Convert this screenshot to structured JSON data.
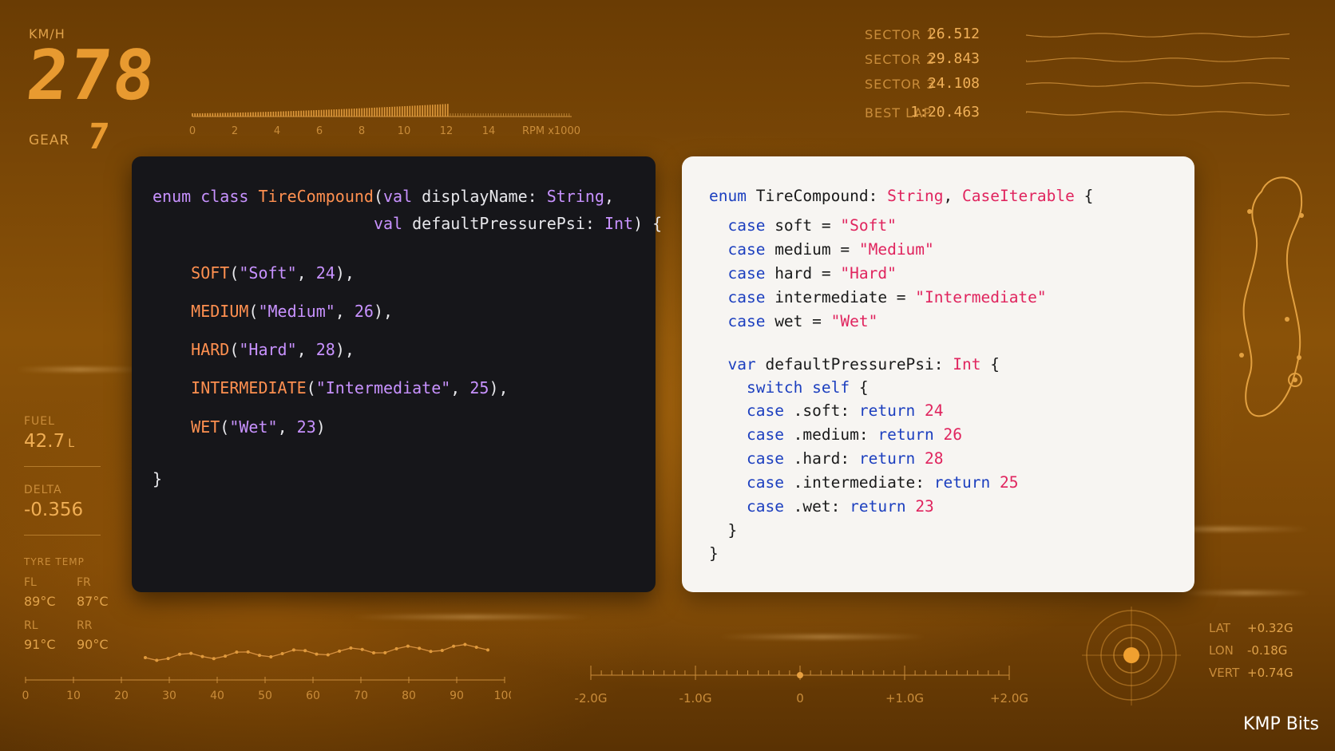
{
  "dashboard": {
    "speed_unit": "KM/H",
    "speed": "278",
    "gear_label": "GEAR",
    "gear": "7",
    "rpm_ticks": [
      "0",
      "2",
      "4",
      "6",
      "8",
      "10",
      "12",
      "14"
    ],
    "rpm_unit": "RPM x1000",
    "rpm_level": 0.68
  },
  "sectors": [
    {
      "label": "SECTOR 1",
      "time": "26.512"
    },
    {
      "label": "SECTOR 2",
      "time": "29.843"
    },
    {
      "label": "SECTOR 3",
      "time": "24.108"
    },
    {
      "label": "BEST LAP",
      "time": "1:20.463"
    }
  ],
  "left_stats": {
    "fuel_label": "FUEL",
    "fuel_value": "42.7",
    "fuel_unit": "L",
    "delta_label": "DELTA",
    "delta_value": "-0.356",
    "tyre_temp_label": "TYRE TEMP",
    "tyres": [
      {
        "pos": "FL",
        "temp": "89°C"
      },
      {
        "pos": "FR",
        "temp": "87°C"
      },
      {
        "pos": "RL",
        "temp": "91°C"
      },
      {
        "pos": "RR",
        "temp": "90°C"
      }
    ]
  },
  "bottom_axis_ticks": [
    "0",
    "10",
    "20",
    "30",
    "40",
    "50",
    "60",
    "70",
    "80",
    "90",
    "100"
  ],
  "g_axis_ticks": [
    "-2.0G",
    "-1.0G",
    "0",
    "+1.0G",
    "+2.0G"
  ],
  "g_forces": [
    {
      "label": "LAT",
      "value": "+0.32G"
    },
    {
      "label": "LON",
      "value": "-0.18G"
    },
    {
      "label": "VERT",
      "value": "+0.74G"
    }
  ],
  "kotlin_code": [
    [
      [
        "kw",
        "enum class "
      ],
      [
        "name",
        "TireCompound"
      ],
      [
        "plain",
        "("
      ],
      [
        "kw",
        "val "
      ],
      [
        "plain",
        "displayName: "
      ],
      [
        "type",
        "String"
      ],
      [
        "plain",
        ","
      ]
    ],
    [
      [
        "plain",
        "                       "
      ],
      [
        "kw",
        "val "
      ],
      [
        "plain",
        "defaultPressurePsi: "
      ],
      [
        "type",
        "Int"
      ],
      [
        "plain",
        ") {"
      ]
    ],
    [],
    [
      [
        "plain",
        "    "
      ],
      [
        "name",
        "SOFT"
      ],
      [
        "plain",
        "("
      ],
      [
        "str",
        "\"Soft\""
      ],
      [
        "plain",
        ", "
      ],
      [
        "num",
        "24"
      ],
      [
        "plain",
        "),"
      ]
    ],
    [
      [
        "plain",
        "    "
      ],
      [
        "name",
        "MEDIUM"
      ],
      [
        "plain",
        "("
      ],
      [
        "str",
        "\"Medium\""
      ],
      [
        "plain",
        ", "
      ],
      [
        "num",
        "26"
      ],
      [
        "plain",
        "),"
      ]
    ],
    [
      [
        "plain",
        "    "
      ],
      [
        "name",
        "HARD"
      ],
      [
        "plain",
        "("
      ],
      [
        "str",
        "\"Hard\""
      ],
      [
        "plain",
        ", "
      ],
      [
        "num",
        "28"
      ],
      [
        "plain",
        "),"
      ]
    ],
    [
      [
        "plain",
        "    "
      ],
      [
        "name",
        "INTERMEDIATE"
      ],
      [
        "plain",
        "("
      ],
      [
        "str",
        "\"Intermediate\""
      ],
      [
        "plain",
        ", "
      ],
      [
        "num",
        "25"
      ],
      [
        "plain",
        "),"
      ]
    ],
    [
      [
        "plain",
        "    "
      ],
      [
        "name",
        "WET"
      ],
      [
        "plain",
        "("
      ],
      [
        "str",
        "\"Wet\""
      ],
      [
        "plain",
        ", "
      ],
      [
        "num",
        "23"
      ],
      [
        "plain",
        ")"
      ]
    ],
    [
      [
        "plain",
        "}"
      ]
    ]
  ],
  "swift_code": [
    [
      [
        "kw",
        "enum "
      ],
      [
        "plain",
        "TireCompound: "
      ],
      [
        "type",
        "String"
      ],
      [
        "plain",
        ", "
      ],
      [
        "type",
        "CaseIterable"
      ],
      [
        "plain",
        " {"
      ]
    ],
    [
      [
        "plain",
        "  "
      ],
      [
        "kw",
        "case "
      ],
      [
        "plain",
        "soft = "
      ],
      [
        "str",
        "\"Soft\""
      ]
    ],
    [
      [
        "plain",
        "  "
      ],
      [
        "kw",
        "case "
      ],
      [
        "plain",
        "medium = "
      ],
      [
        "str",
        "\"Medium\""
      ]
    ],
    [
      [
        "plain",
        "  "
      ],
      [
        "kw",
        "case "
      ],
      [
        "plain",
        "hard = "
      ],
      [
        "str",
        "\"Hard\""
      ]
    ],
    [
      [
        "plain",
        "  "
      ],
      [
        "kw",
        "case "
      ],
      [
        "plain",
        "intermediate = "
      ],
      [
        "str",
        "\"Intermediate\""
      ]
    ],
    [
      [
        "plain",
        "  "
      ],
      [
        "kw",
        "case "
      ],
      [
        "plain",
        "wet = "
      ],
      [
        "str",
        "\"Wet\""
      ]
    ],
    [],
    [
      [
        "plain",
        "  "
      ],
      [
        "kw",
        "var "
      ],
      [
        "plain",
        "defaultPressurePsi: "
      ],
      [
        "type",
        "Int"
      ],
      [
        "plain",
        " {"
      ]
    ],
    [
      [
        "plain",
        "    "
      ],
      [
        "kw",
        "switch self "
      ],
      [
        "plain",
        "{"
      ]
    ],
    [
      [
        "plain",
        "    "
      ],
      [
        "kw",
        "case "
      ],
      [
        "plain",
        ".soft: "
      ],
      [
        "kw",
        "return "
      ],
      [
        "num",
        "24"
      ]
    ],
    [
      [
        "plain",
        "    "
      ],
      [
        "kw",
        "case "
      ],
      [
        "plain",
        ".medium: "
      ],
      [
        "kw",
        "return "
      ],
      [
        "num",
        "26"
      ]
    ],
    [
      [
        "plain",
        "    "
      ],
      [
        "kw",
        "case "
      ],
      [
        "plain",
        ".hard: "
      ],
      [
        "kw",
        "return "
      ],
      [
        "num",
        "28"
      ]
    ],
    [
      [
        "plain",
        "    "
      ],
      [
        "kw",
        "case "
      ],
      [
        "plain",
        ".intermediate: "
      ],
      [
        "kw",
        "return "
      ],
      [
        "num",
        "25"
      ]
    ],
    [
      [
        "plain",
        "    "
      ],
      [
        "kw",
        "case "
      ],
      [
        "plain",
        ".wet: "
      ],
      [
        "kw",
        "return "
      ],
      [
        "num",
        "23"
      ]
    ],
    [
      [
        "plain",
        "  }"
      ]
    ],
    [
      [
        "plain",
        "}"
      ]
    ]
  ],
  "brand": "KMP Bits"
}
